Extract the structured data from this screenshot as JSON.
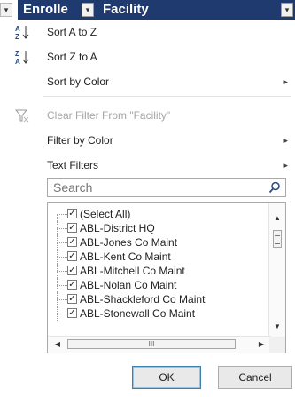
{
  "header": {
    "left_arrow_icon": "dropdown-arrow-icon",
    "enroll_label": "Enrolle",
    "facility_label": "Facility"
  },
  "menu": {
    "items": [
      {
        "icon": "sort-a-to-z-icon",
        "label": "Sort A to Z"
      },
      {
        "icon": "sort-z-to-a-icon",
        "label": "Sort Z to A"
      },
      {
        "label": "Sort by Color"
      },
      {
        "icon": "clear-filter-icon",
        "label": "Clear Filter From \"Facility\""
      },
      {
        "label": "Filter by Color"
      },
      {
        "label": "Text Filters"
      }
    ],
    "submenu_arrow": "▸"
  },
  "search": {
    "placeholder": "Search"
  },
  "list": {
    "items": [
      {
        "label": "(Select All)",
        "checked": true
      },
      {
        "label": "ABL-District HQ",
        "checked": true
      },
      {
        "label": "ABL-Jones Co Maint",
        "checked": true
      },
      {
        "label": "ABL-Kent Co Maint",
        "checked": true
      },
      {
        "label": "ABL-Mitchell Co Maint",
        "checked": true
      },
      {
        "label": "ABL-Nolan Co Maint",
        "checked": true
      },
      {
        "label": "ABL-Shackleford Co Maint",
        "checked": true
      },
      {
        "label": "ABL-Stonewall Co Maint",
        "checked": true
      }
    ],
    "hscroll_thumb_label": "III"
  },
  "buttons": {
    "ok": "OK",
    "cancel": "Cancel"
  },
  "colors": {
    "header_bg": "#1f3a6e",
    "accent": "#3c7fb1"
  }
}
